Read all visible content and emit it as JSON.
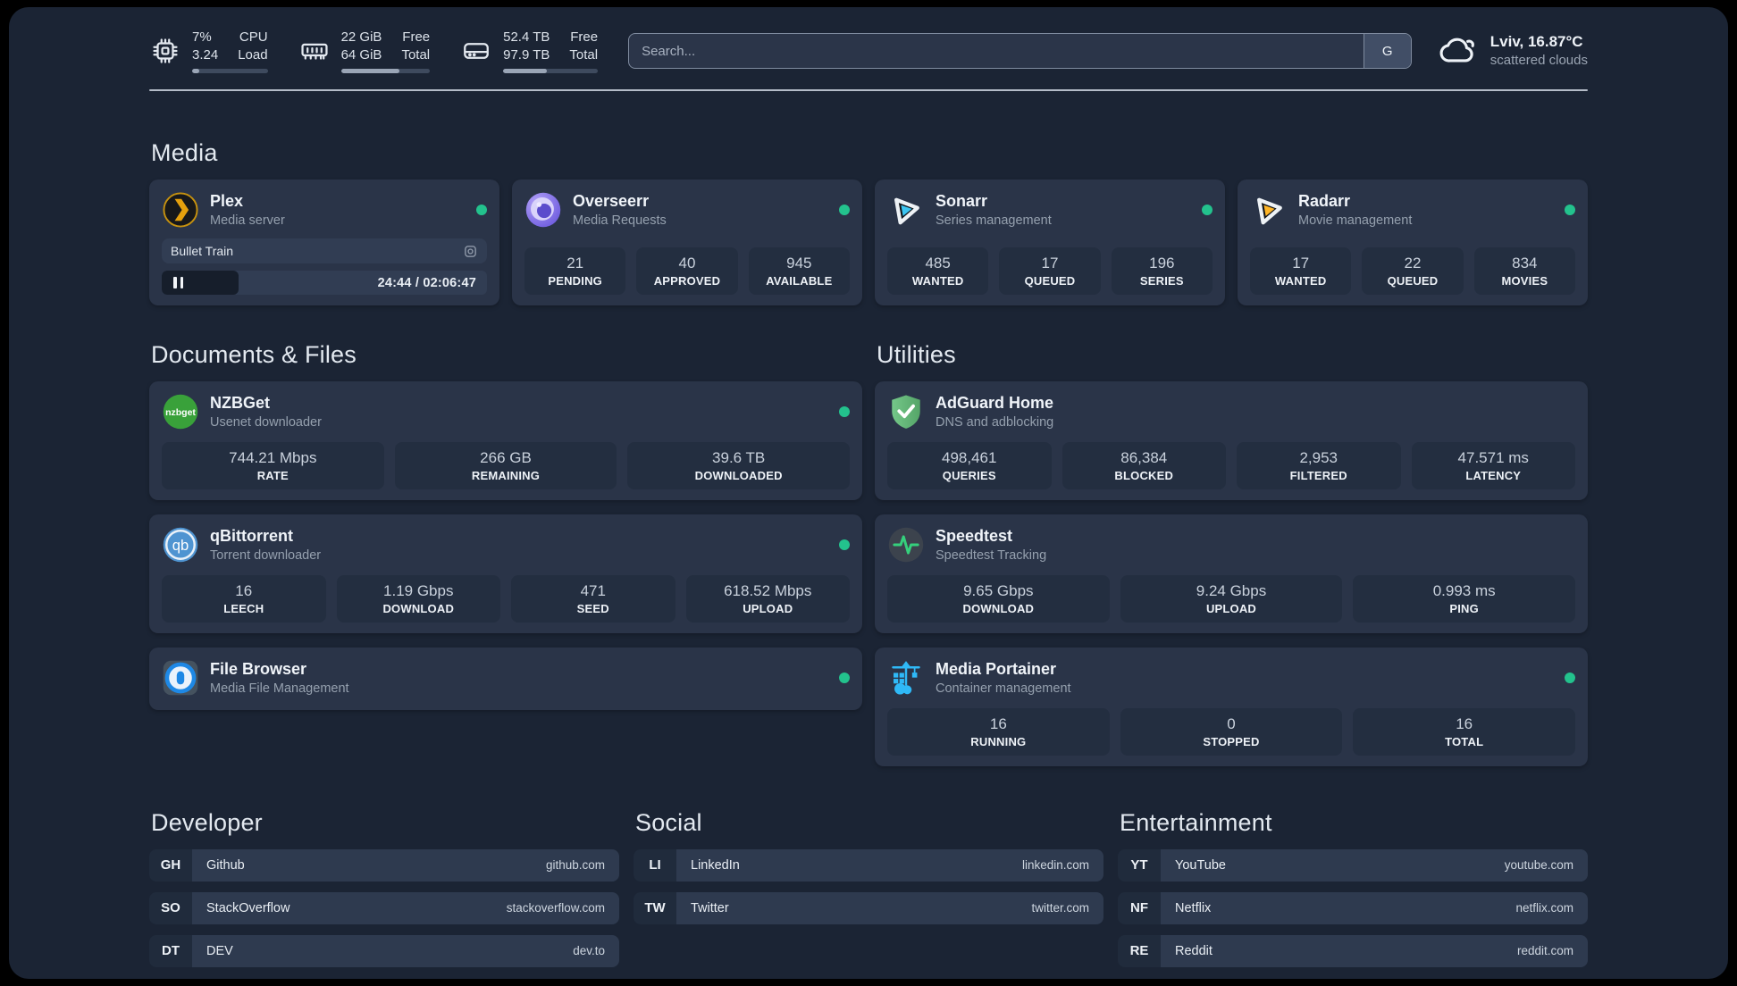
{
  "header": {
    "system_stats": [
      {
        "id": "cpu",
        "icon": "cpu-icon",
        "metrics": [
          {
            "value": "7%",
            "label": "CPU"
          },
          {
            "value": "3.24",
            "label": "Load"
          }
        ],
        "progress_pct": 10
      },
      {
        "id": "memory",
        "icon": "memory-icon",
        "metrics": [
          {
            "value": "22 GiB",
            "label": "Free"
          },
          {
            "value": "64 GiB",
            "label": "Total"
          }
        ],
        "progress_pct": 66
      },
      {
        "id": "disk",
        "icon": "disk-icon",
        "metrics": [
          {
            "value": "52.4 TB",
            "label": "Free"
          },
          {
            "value": "97.9 TB",
            "label": "Total"
          }
        ],
        "progress_pct": 46
      }
    ],
    "search": {
      "placeholder": "Search...",
      "button_label": "G"
    },
    "weather": {
      "icon": "cloud-icon",
      "title": "Lviv, 16.87°C",
      "subtitle": "scattered clouds"
    }
  },
  "app_sections": [
    {
      "title": "Media",
      "apps": [
        {
          "id": "plex",
          "icon": "plex-icon",
          "name": "Plex",
          "desc": "Media server",
          "online": true,
          "player": {
            "title": "Bullet Train",
            "state": "paused",
            "time": "24:44 / 02:06:47",
            "progress_pct": 20,
            "session_icon": "session-icon"
          }
        },
        {
          "id": "overseerr",
          "icon": "overseerr-icon",
          "name": "Overseerr",
          "desc": "Media Requests",
          "online": true,
          "stats": [
            {
              "value": "21",
              "label": "PENDING"
            },
            {
              "value": "40",
              "label": "APPROVED"
            },
            {
              "value": "945",
              "label": "AVAILABLE"
            }
          ]
        },
        {
          "id": "sonarr",
          "icon": "sonarr-icon",
          "name": "Sonarr",
          "desc": "Series management",
          "online": true,
          "stats": [
            {
              "value": "485",
              "label": "WANTED"
            },
            {
              "value": "17",
              "label": "QUEUED"
            },
            {
              "value": "196",
              "label": "SERIES"
            }
          ]
        },
        {
          "id": "radarr",
          "icon": "radarr-icon",
          "name": "Radarr",
          "desc": "Movie management",
          "online": true,
          "stats": [
            {
              "value": "17",
              "label": "WANTED"
            },
            {
              "value": "22",
              "label": "QUEUED"
            },
            {
              "value": "834",
              "label": "MOVIES"
            }
          ]
        }
      ]
    },
    {
      "title": "Documents & Files",
      "apps": [
        {
          "id": "nzbget",
          "icon": "nzbget-icon",
          "name": "NZBGet",
          "desc": "Usenet downloader",
          "online": true,
          "stats": [
            {
              "value": "744.21 Mbps",
              "label": "RATE"
            },
            {
              "value": "266 GB",
              "label": "REMAINING"
            },
            {
              "value": "39.6 TB",
              "label": "DOWNLOADED"
            }
          ]
        },
        {
          "id": "qbittorrent",
          "icon": "qbittorrent-icon",
          "name": "qBittorrent",
          "desc": "Torrent downloader",
          "online": true,
          "stats": [
            {
              "value": "16",
              "label": "LEECH"
            },
            {
              "value": "1.19 Gbps",
              "label": "DOWNLOAD"
            },
            {
              "value": "471",
              "label": "SEED"
            },
            {
              "value": "618.52 Mbps",
              "label": "UPLOAD"
            }
          ]
        },
        {
          "id": "filebrowser",
          "icon": "filebrowser-icon",
          "name": "File Browser",
          "desc": "Media File Management",
          "online": true
        }
      ]
    },
    {
      "title": "Utilities",
      "apps": [
        {
          "id": "adguard",
          "icon": "adguard-icon",
          "name": "AdGuard Home",
          "desc": "DNS and adblocking",
          "online": false,
          "stats": [
            {
              "value": "498,461",
              "label": "QUERIES"
            },
            {
              "value": "86,384",
              "label": "BLOCKED"
            },
            {
              "value": "2,953",
              "label": "FILTERED"
            },
            {
              "value": "47.571 ms",
              "label": "LATENCY"
            }
          ]
        },
        {
          "id": "speedtest",
          "icon": "speedtest-icon",
          "name": "Speedtest",
          "desc": "Speedtest Tracking",
          "online": false,
          "stats": [
            {
              "value": "9.65 Gbps",
              "label": "DOWNLOAD"
            },
            {
              "value": "9.24 Gbps",
              "label": "UPLOAD"
            },
            {
              "value": "0.993 ms",
              "label": "PING"
            }
          ]
        },
        {
          "id": "portainer",
          "icon": "portainer-icon",
          "name": "Media Portainer",
          "desc": "Container management",
          "online": true,
          "stats": [
            {
              "value": "16",
              "label": "RUNNING"
            },
            {
              "value": "0",
              "label": "STOPPED"
            },
            {
              "value": "16",
              "label": "TOTAL"
            }
          ]
        }
      ]
    }
  ],
  "link_sections": [
    {
      "title": "Developer",
      "links": [
        {
          "abbr": "GH",
          "name": "Github",
          "url": "github.com"
        },
        {
          "abbr": "SO",
          "name": "StackOverflow",
          "url": "stackoverflow.com"
        },
        {
          "abbr": "DT",
          "name": "DEV",
          "url": "dev.to"
        }
      ]
    },
    {
      "title": "Social",
      "links": [
        {
          "abbr": "LI",
          "name": "LinkedIn",
          "url": "linkedin.com"
        },
        {
          "abbr": "TW",
          "name": "Twitter",
          "url": "twitter.com"
        }
      ]
    },
    {
      "title": "Entertainment",
      "links": [
        {
          "abbr": "YT",
          "name": "YouTube",
          "url": "youtube.com"
        },
        {
          "abbr": "NF",
          "name": "Netflix",
          "url": "netflix.com"
        },
        {
          "abbr": "RE",
          "name": "Reddit",
          "url": "reddit.com"
        }
      ]
    }
  ],
  "colors": {
    "status_online": "#23c28d",
    "plex_accent": "#e5a00d",
    "sonarr_accent": "#3cc5f1",
    "radarr_accent": "#ffb526"
  }
}
